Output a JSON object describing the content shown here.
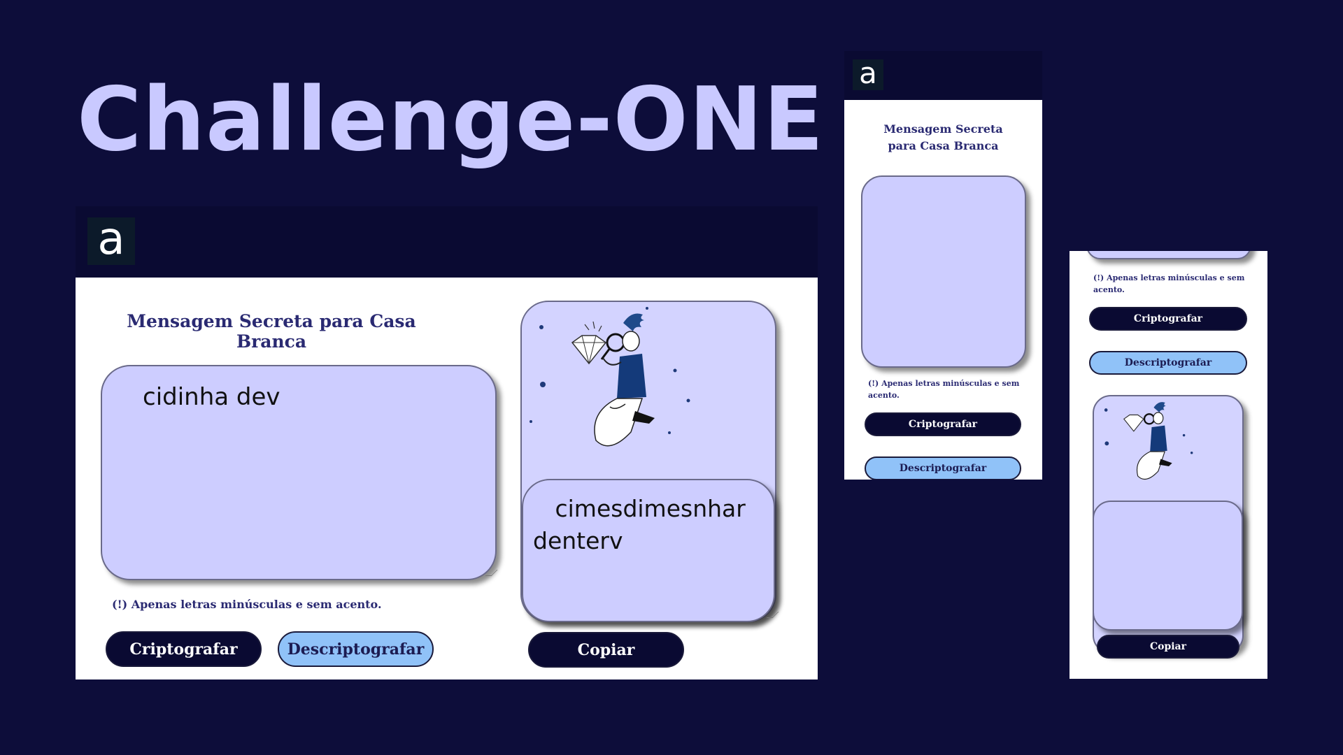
{
  "title": "Challenge-ONE",
  "logo_letter": "a",
  "app": {
    "heading": "Mensagem Secreta para Casa Branca",
    "heading_mobile_line1": "Mensagem Secreta",
    "heading_mobile_line2": "para Casa Branca",
    "input_text": "cidinha dev",
    "output_text": "   cimesdimesnhar\ndenterv",
    "note": "(!) Apenas letras minúsculas e sem acento.",
    "note_line1": "(!) Apenas letras minúsculas e sem",
    "note_line2": "acento.",
    "encrypt_label": "Criptografar",
    "decrypt_label": "Descriptografar",
    "copy_label": "Copiar"
  },
  "colors": {
    "background": "#0d0d3a",
    "title": "#c9c9ff",
    "panel": "#cdcdff",
    "button_dark": "#0a0a32",
    "button_light": "#90c2f8"
  }
}
